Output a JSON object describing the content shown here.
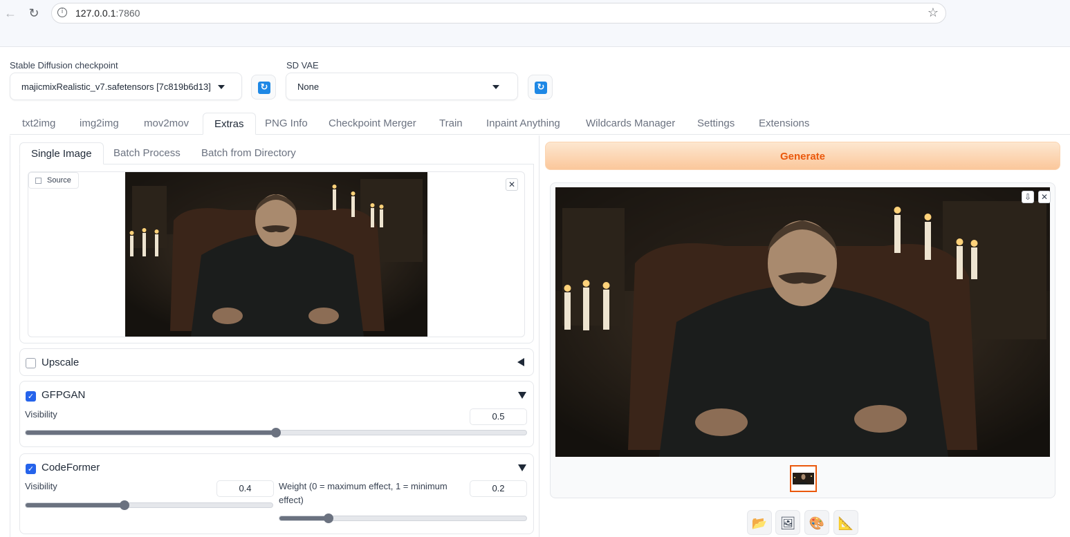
{
  "browser": {
    "url_host": "127.0.0.1",
    "url_port": ":7860"
  },
  "settings": {
    "checkpoint_label": "Stable Diffusion checkpoint",
    "checkpoint_value": "majicmixRealistic_v7.safetensors [7c819b6d13]",
    "vae_label": "SD VAE",
    "vae_value": "None"
  },
  "main_tabs": [
    "txt2img",
    "img2img",
    "mov2mov",
    "Extras",
    "PNG Info",
    "Checkpoint Merger",
    "Train",
    "Inpaint Anything",
    "Wildcards Manager",
    "Settings",
    "Extensions"
  ],
  "active_main_tab": "Extras",
  "sub_tabs": [
    "Single Image",
    "Batch Process",
    "Batch from Directory"
  ],
  "active_sub_tab": "Single Image",
  "source": {
    "label": "Source"
  },
  "upscale": {
    "title": "Upscale",
    "checked": false
  },
  "gfpgan": {
    "title": "GFPGAN",
    "checked": true,
    "visibility_label": "Visibility",
    "visibility": "0.5",
    "visibility_frac": 0.5
  },
  "codeformer": {
    "title": "CodeFormer",
    "checked": true,
    "visibility_label": "Visibility",
    "visibility": "0.4",
    "visibility_frac": 0.4,
    "weight_label": "Weight (0 = maximum effect, 1 = minimum effect)",
    "weight": "0.2",
    "weight_frac": 0.2
  },
  "output": {
    "generate_label": "Generate"
  },
  "tools": [
    "folder-icon",
    "image-icon",
    "palette-icon",
    "ruler-icon"
  ],
  "colors": {
    "accent": "#ea580c",
    "checkbox": "#2563eb",
    "refresh": "#1e88e5"
  }
}
